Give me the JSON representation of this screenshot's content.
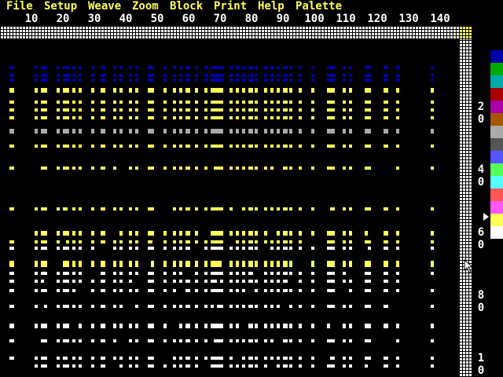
{
  "menu": [
    "File",
    "Setup",
    "Weave",
    "Zoom",
    "Block",
    "Print",
    "Help",
    "Palette"
  ],
  "ruler_top": [
    "10",
    "20",
    "30",
    "40",
    "50",
    "60",
    "70",
    "80",
    "90",
    "100",
    "110",
    "120",
    "130",
    "140"
  ],
  "ruler_right": [
    {
      "line1": "2",
      "line2": "0"
    },
    {
      "line1": "4",
      "line2": "0"
    },
    {
      "line1": "6",
      "line2": "0"
    },
    {
      "line1": "8",
      "line2": "0"
    },
    {
      "line1": "1",
      "line2": "0"
    }
  ],
  "palette": {
    "colors": [
      "#0000aa",
      "#00aa00",
      "#00aaaa",
      "#aa0000",
      "#aa00aa",
      "#aa5500",
      "#aaaaaa",
      "#555555",
      "#5555ff",
      "#55ff55",
      "#55ffff",
      "#ff5555",
      "#ff55ff",
      "#ffff55",
      "#ffffff"
    ],
    "selected_index": 13
  },
  "colors": {
    "menu_text": "#ffff55",
    "background": "#000000",
    "warp_blue": "#0000aa",
    "weft_yellow": "#ffff55",
    "weft_white": "#ffffff",
    "weft_gray": "#aaaaaa"
  }
}
